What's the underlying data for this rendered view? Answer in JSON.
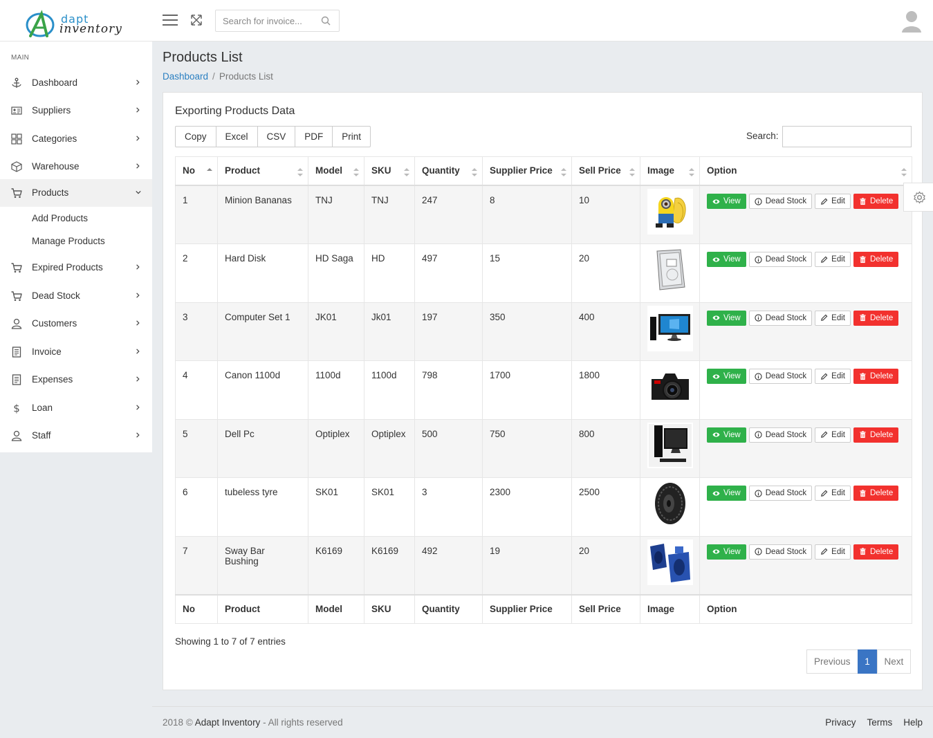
{
  "app": {
    "logo_top": "dapt",
    "logo_bottom": "inventory"
  },
  "topbar": {
    "search_placeholder": "Search for invoice..."
  },
  "sidebar": {
    "section": "MAIN",
    "items": [
      {
        "label": "Dashboard",
        "icon": "anchor-icon"
      },
      {
        "label": "Suppliers",
        "icon": "id-card-icon"
      },
      {
        "label": "Categories",
        "icon": "grid-icon"
      },
      {
        "label": "Warehouse",
        "icon": "box-icon"
      },
      {
        "label": "Products",
        "icon": "cart-icon",
        "active": true
      },
      {
        "label": "Expired Products",
        "icon": "cart-icon"
      },
      {
        "label": "Dead Stock",
        "icon": "cart-icon"
      },
      {
        "label": "Customers",
        "icon": "user-icon"
      },
      {
        "label": "Invoice",
        "icon": "document-icon"
      },
      {
        "label": "Expenses",
        "icon": "document-icon"
      },
      {
        "label": "Loan",
        "icon": "dollar-icon"
      },
      {
        "label": "Staff",
        "icon": "user-icon"
      }
    ],
    "sub_items": [
      "Add Products",
      "Manage Products"
    ]
  },
  "page": {
    "title": "Products List",
    "breadcrumb_home": "Dashboard",
    "breadcrumb_current": "Products List"
  },
  "card": {
    "title": "Exporting Products Data",
    "export_buttons": [
      "Copy",
      "Excel",
      "CSV",
      "PDF",
      "Print"
    ],
    "search_label": "Search:",
    "columns": [
      "No",
      "Product",
      "Model",
      "SKU",
      "Quantity",
      "Supplier Price",
      "Sell Price",
      "Image",
      "Option"
    ],
    "rows": [
      {
        "no": "1",
        "product": "Minion Bananas",
        "model": "TNJ",
        "sku": "TNJ",
        "quantity": "247",
        "supplier_price": "8",
        "sell_price": "10",
        "image": "minion"
      },
      {
        "no": "2",
        "product": "Hard Disk",
        "model": "HD Saga",
        "sku": "HD",
        "quantity": "497",
        "supplier_price": "15",
        "sell_price": "20",
        "image": "harddisk"
      },
      {
        "no": "3",
        "product": "Computer Set 1",
        "model": "JK01",
        "sku": "Jk01",
        "quantity": "197",
        "supplier_price": "350",
        "sell_price": "400",
        "image": "computer"
      },
      {
        "no": "4",
        "product": "Canon 1100d",
        "model": "1100d",
        "sku": "1100d",
        "quantity": "798",
        "supplier_price": "1700",
        "sell_price": "1800",
        "image": "camera"
      },
      {
        "no": "5",
        "product": "Dell Pc",
        "model": "Optiplex",
        "sku": "Optiplex",
        "quantity": "500",
        "supplier_price": "750",
        "sell_price": "800",
        "image": "dellpc"
      },
      {
        "no": "6",
        "product": "tubeless tyre",
        "model": "SK01",
        "sku": "SK01",
        "quantity": "3",
        "supplier_price": "2300",
        "sell_price": "2500",
        "image": "tyre"
      },
      {
        "no": "7",
        "product": "Sway Bar Bushing",
        "model": "K6169",
        "sku": "K6169",
        "quantity": "492",
        "supplier_price": "19",
        "sell_price": "20",
        "image": "bushing"
      }
    ],
    "option_buttons": {
      "view": "View",
      "dead": "Dead Stock",
      "edit": "Edit",
      "delete": "Delete"
    },
    "info": "Showing 1 to 7 of 7 entries",
    "pager": {
      "prev": "Previous",
      "current": "1",
      "next": "Next"
    }
  },
  "footer": {
    "year": "2018 ©",
    "brand": "Adapt Inventory",
    "rights": "- All rights reserved",
    "links": [
      "Privacy",
      "Terms",
      "Help"
    ]
  },
  "colors": {
    "view": "#2fb14a",
    "delete": "#f2312e",
    "link": "#2a7fc1",
    "pager_active": "#3a75c4"
  }
}
